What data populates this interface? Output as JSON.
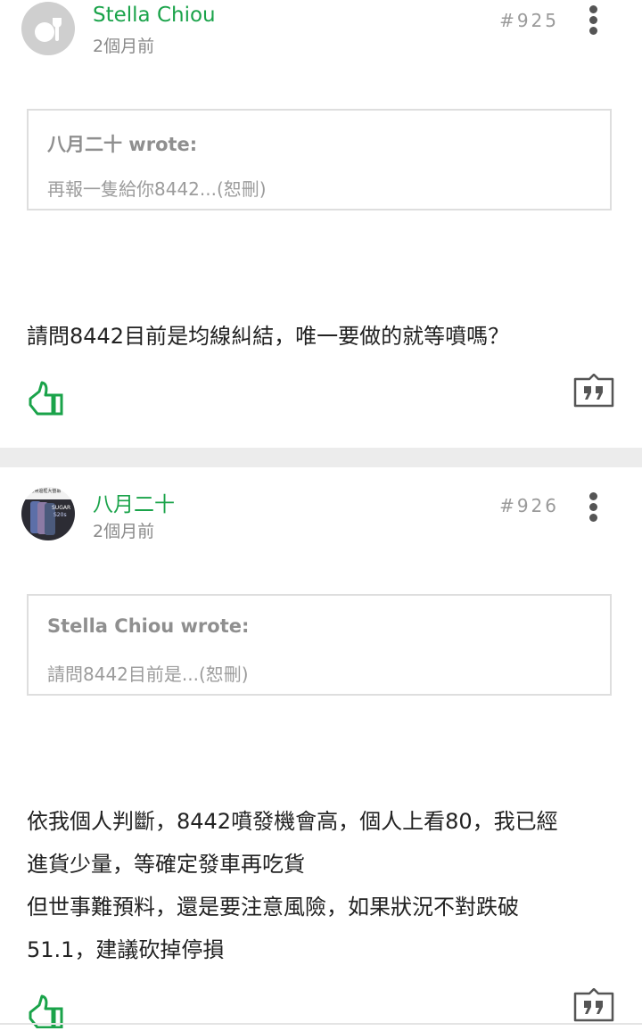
{
  "posts": [
    {
      "author": "Stella Chiou",
      "time": "2個月前",
      "floor": "#925",
      "quote_title": "八月二十 wrote:",
      "quote_text": "再報一隻給你8442...(恕刪)",
      "content_lines": [
        "請問8442目前是均線糾結，唯一要做的就等噴嗎？"
      ]
    },
    {
      "author": "八月二十",
      "time": "2個月前",
      "floor": "#926",
      "avatar_banner": "18吋無邊框大螢幕",
      "avatar_brand": "SUGAR",
      "avatar_model": "S20s",
      "quote_title": "Stella Chiou wrote:",
      "quote_text": "請問8442目前是...(恕刪)",
      "content_lines": [
        "依我個人判斷，8442噴發機會高，個人上看80，我已經",
        "進貨少量，等確定發車再吃貨",
        "但世事難預料，還是要注意風險，如果狀況不對跌破",
        "51.1，建議砍掉停損"
      ]
    }
  ],
  "colors": {
    "accent": "#1aa34a",
    "separator": "#ececec",
    "muted": "#8a8a8a"
  },
  "icons": [
    "default-avatar-icon",
    "more-options-icon",
    "thumbs-up-icon",
    "quote-reply-icon"
  ]
}
